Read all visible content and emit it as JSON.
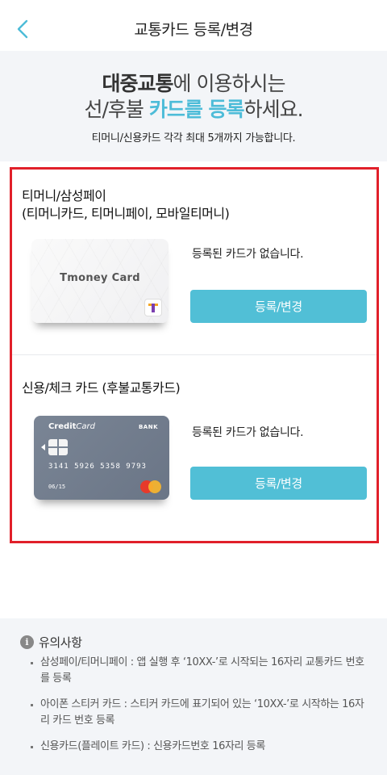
{
  "header": {
    "title": "교통카드 등록/변경"
  },
  "intro": {
    "line1_highlight": "대중교통",
    "line1_rest": "에 이용하시는",
    "line2_start": "선/후불 ",
    "line2_highlight": "카드를 등록",
    "line2_end": "하세요.",
    "subtitle": "티머니/신용카드 각각 최대 5개까지 가능합니다."
  },
  "tmoney_section": {
    "title_line1": "티머니/삼성페이",
    "title_line2": "(티머니카드, 티머니페이, 모바일티머니)",
    "card_label": "Tmoney Card",
    "status": "등록된 카드가 없습니다.",
    "button_label": "등록/변경"
  },
  "credit_section": {
    "title": "신용/체크 카드 (후불교통카드)",
    "card_brand_bold": "Credit",
    "card_brand_light": "Card",
    "card_bank": "BANK",
    "card_number": "3141 5926 5358 9793",
    "card_expiry": "06/15",
    "status": "등록된 카드가 없습니다.",
    "button_label": "등록/변경"
  },
  "notice": {
    "title": "유의사항",
    "items": [
      "삼성페이/티머니페이 : 앱 실행 후 ‘10XX-’로 시작되는 16자리 교통카드 번호를 등록",
      "아이폰 스티커 카드 : 스티커 카드에 표기되어 있는 ‘10XX-’로 시작하는 16자리 카드 번호 등록",
      "신용카드(플레이트 카드) : 신용카드번호 16자리 등록"
    ]
  },
  "colors": {
    "accent": "#51bfd6",
    "highlight_box": "#e1202a",
    "panel_bg": "#f3f5f8"
  }
}
